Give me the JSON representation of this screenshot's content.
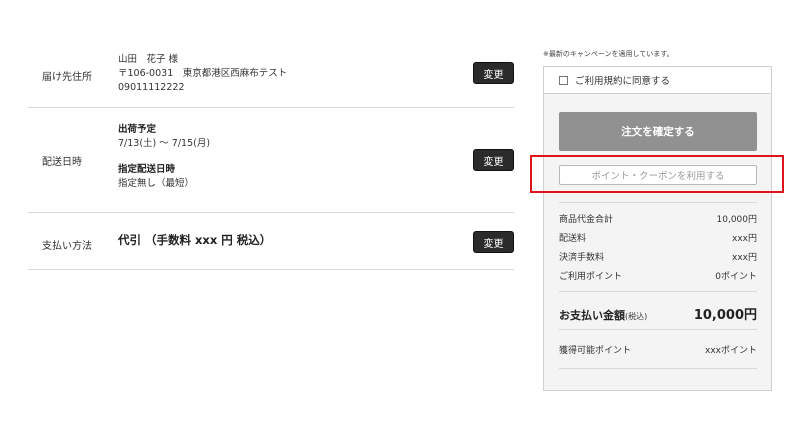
{
  "shipping": {
    "label": "届け先住所",
    "name": "山田　花子 様",
    "address": "〒106-0031　東京都港区西麻布テスト",
    "phone": "09011112222",
    "change_label": "変更"
  },
  "delivery": {
    "label": "配送日時",
    "ship_title": "出荷予定",
    "ship_range": "7/13(土) 〜 7/15(月)",
    "specified_title": "指定配送日時",
    "specified_value": "指定無し（最短）",
    "change_label": "変更"
  },
  "payment": {
    "label": "支払い方法",
    "value": "代引 （手数料 xxx 円 税込）",
    "change_label": "変更"
  },
  "summary": {
    "campaign_note": "※最新のキャンペーンを適用しています。",
    "agree_label": "ご利用規約に同意する",
    "confirm_label": "注文を確定する",
    "coupon_label": "ポイント・クーポンを利用する",
    "rows": [
      {
        "label": "商品代金合計",
        "value": "10,000円"
      },
      {
        "label": "配送料",
        "value": "xxx円"
      },
      {
        "label": "決済手数料",
        "value": "xxx円"
      },
      {
        "label": "ご利用ポイント",
        "value": "0ポイント"
      }
    ],
    "total_label": "お支払い金額",
    "total_suffix": "(税込)",
    "total_value": "10,000円",
    "points_label": "獲得可能ポイント",
    "points_value": "xxxポイント"
  },
  "colors": {
    "highlight": "#e0121a",
    "change_button": "#2b2b2b",
    "confirm_button": "#919191",
    "panel_bg": "#f4f4f5"
  },
  "icons": {
    "agree_checkbox": "checkbox-unchecked-icon"
  }
}
